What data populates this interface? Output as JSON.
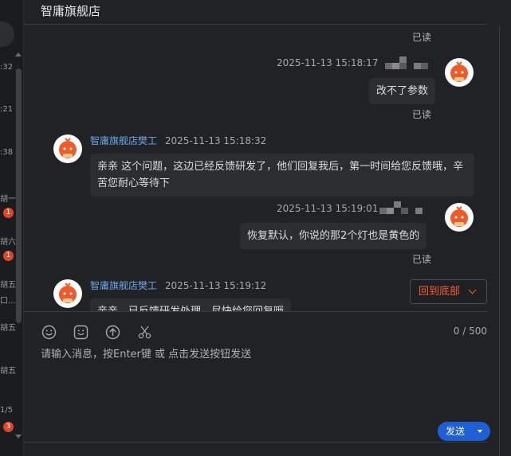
{
  "header": {
    "title": "智庸旗舰店"
  },
  "left_strip": {
    "times": [
      ":32",
      ":21",
      ":38",
      "胡一",
      "胡六",
      "胡五",
      "口...",
      "胡五",
      "胡五",
      "1/5"
    ],
    "badges": [
      "1",
      "1",
      "3"
    ]
  },
  "messages": {
    "top_read": "已读",
    "m1": {
      "time": "2025-11-13 15:18:17",
      "text": "改不了参数",
      "read": "已读"
    },
    "m2": {
      "name": "智庸旗舰店樊工",
      "time": "2025-11-13 15:18:32",
      "text": "亲亲 这个问题，这边已经反馈研发了，他们回复我后，第一时间给您反馈哦，辛苦您耐心等待下"
    },
    "m3": {
      "time": "2025-11-13 15:19:01",
      "text": "恢复默认，你说的那2个灯也是黄色的",
      "read": "已读"
    },
    "m4": {
      "name": "智庸旗舰店樊工",
      "time": "2025-11-13 15:19:12",
      "text": "亲亲，已反馈研发处理，尽快给您回复哦"
    }
  },
  "back_to_bottom": "回到底部",
  "composer": {
    "char_count": "0 / 500",
    "placeholder": "请输入消息，按Enter键 或 点击发送按钮发送",
    "tools": [
      "emoji-icon",
      "sticker-icon",
      "upload-icon",
      "scissors-icon"
    ]
  },
  "send": {
    "label": "发送"
  },
  "colors": {
    "accent": "#ff5a36",
    "send": "#1f5fd6",
    "name": "#6fa8e8",
    "background": "#202225"
  }
}
